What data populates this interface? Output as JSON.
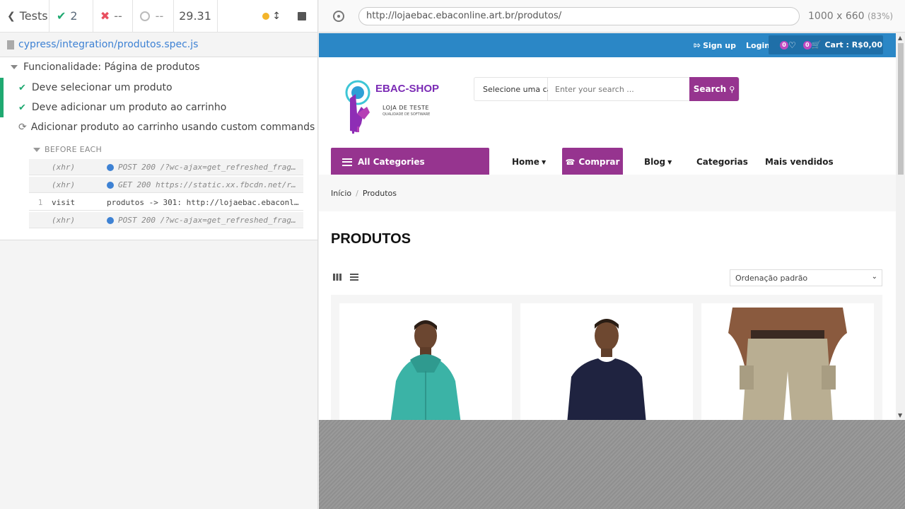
{
  "reporter": {
    "tests_label": "Tests",
    "passed_count": "2",
    "failed_count": "--",
    "pending_count": "--",
    "duration": "29.31",
    "spec_path": "cypress/integration/produtos.spec.js",
    "suite_title": "Funcionalidade: Página de produtos",
    "tests": [
      {
        "title": "Deve selecionar um produto",
        "state": "passed"
      },
      {
        "title": "Deve adicionar um produto ao carrinho",
        "state": "passed"
      },
      {
        "title": "Adicionar produto ao carrinho usando custom commands",
        "state": "running"
      }
    ],
    "hook_label": "BEFORE EACH",
    "commands": [
      {
        "num": "",
        "name": "(xhr)",
        "message": "POST 200 /?wc-ajax=get_refreshed_frag…"
      },
      {
        "num": "",
        "name": "(xhr)",
        "message": "GET 200 https://static.xx.fbcdn.net/r…"
      },
      {
        "num": "1",
        "name": "visit",
        "message": "produtos -> 301: http://lojaebac.ebaconl…"
      },
      {
        "num": "",
        "name": "(xhr)",
        "message": "POST 200 /?wc-ajax=get_refreshed_frag…"
      }
    ]
  },
  "aut": {
    "url": "http://lojaebac.ebaconline.art.br/produtos/",
    "viewport": "1000 x 660",
    "scale": "(83%)"
  },
  "site": {
    "signup": "Sign up",
    "login": "Login",
    "wishlist_count": "0",
    "cart_count": "0",
    "cart_label": "Cart : R$0,00",
    "logo_title": "EBAC-SHOP",
    "logo_subtitle": "LOJA DE TESTE",
    "logo_tagline": "QUALIDADE DE SOFTWARE",
    "search_category": "Selecione uma cat",
    "search_placeholder": "Enter your search ...",
    "search_button": "Search",
    "all_categories": "All Categories",
    "nav": {
      "home": "Home",
      "comprar": "Comprar",
      "blog": "Blog",
      "categorias": "Categorias",
      "mais_vendidos": "Mais vendidos"
    },
    "breadcrumb": [
      "Início",
      "Produtos"
    ],
    "page_title": "PRODUTOS",
    "sort_selected": "Ordenação padrão"
  },
  "colors": {
    "brand_purple": "#96348f",
    "topbar_blue": "#2b87c6",
    "pass_green": "#1fa971",
    "fail_red": "#e94f5f"
  }
}
